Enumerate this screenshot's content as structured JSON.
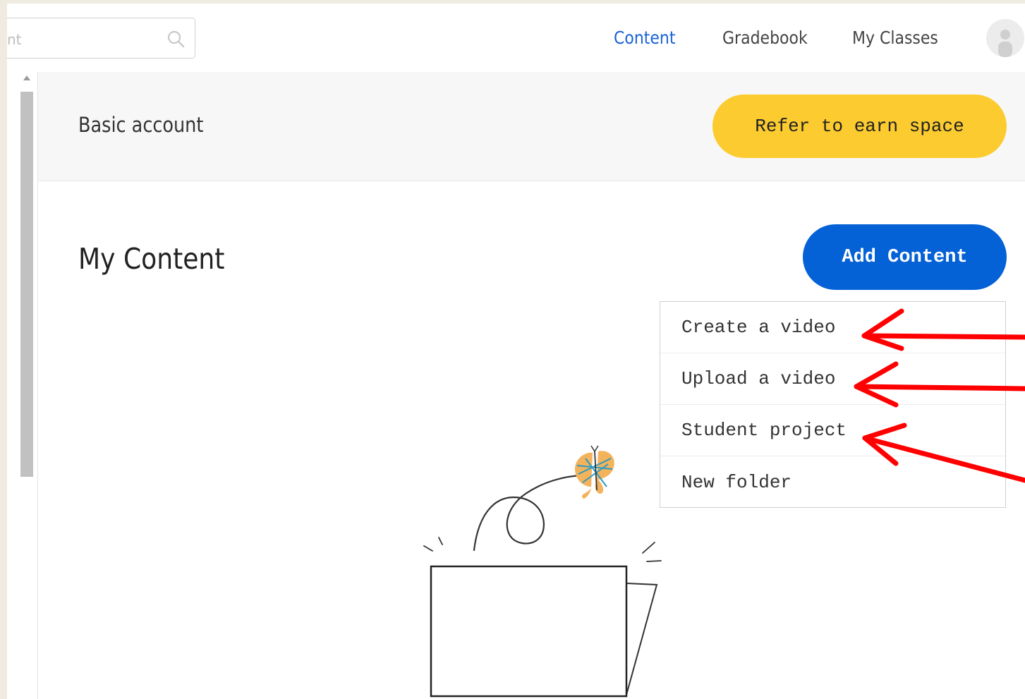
{
  "search": {
    "placeholder_fragment": "nt"
  },
  "nav": {
    "items": [
      {
        "label": "Content",
        "active": true
      },
      {
        "label": "Gradebook",
        "active": false
      },
      {
        "label": "My Classes",
        "active": false
      }
    ]
  },
  "account": {
    "label": "Basic account",
    "refer_button": "Refer to earn space"
  },
  "main": {
    "title": "My Content",
    "add_button": "Add Content"
  },
  "dropdown": {
    "items": [
      {
        "label": "Create a video"
      },
      {
        "label": "Upload a video"
      },
      {
        "label": "Student project"
      },
      {
        "label": "New folder"
      }
    ]
  },
  "colors": {
    "accent_blue": "#0561d6",
    "nav_active": "#1a63d8",
    "refer_yellow": "#fccb2f",
    "annotation_red": "#ff0000",
    "page_background": "#efebe1"
  },
  "icons": {
    "search": "search-icon",
    "avatar": "user-avatar-icon",
    "illustration": "empty-folder-with-butterfly-illustration",
    "annotation": "red-arrow"
  }
}
